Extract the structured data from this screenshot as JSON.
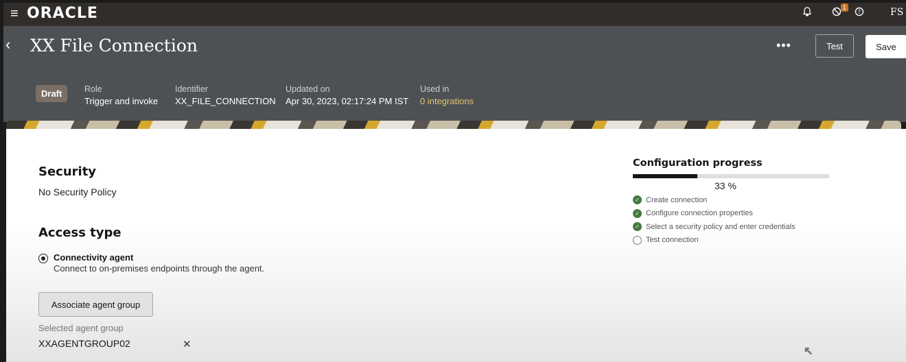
{
  "topbar": {
    "logo": "ORACLE",
    "menu_icon": "hamburger-menu-icon",
    "notification_icon": "bell-icon",
    "activity_icon": "activity-icon",
    "activity_badge": "1",
    "help_icon": "help-icon",
    "user_initials": "FS",
    "colors": {
      "background": "#302d2b",
      "badge": "#c7762b"
    }
  },
  "header": {
    "title": "XX File Connection",
    "more_label": "•••",
    "test_label": "Test",
    "save_label": "Save",
    "status_badge": "Draft",
    "meta": {
      "role_label": "Role",
      "role_value": "Trigger and invoke",
      "identifier_label": "Identifier",
      "identifier_value": "XX_FILE_CONNECTION",
      "updated_label": "Updated on",
      "updated_value": "Apr 30, 2023, 02:17:24 PM IST",
      "used_label": "Used in",
      "used_value": "0 integrations"
    },
    "colors": {
      "background": "#4e5154",
      "link": "#e3c56e"
    }
  },
  "security": {
    "title": "Security",
    "value": "No Security Policy"
  },
  "access": {
    "title": "Access type",
    "option_title": "Connectivity agent",
    "option_desc": "Connect to on-premises endpoints through the agent.",
    "option_selected": true,
    "associate_button": "Associate agent group",
    "selected_label": "Selected agent group",
    "selected_value": "XXAGENTGROUP02",
    "clear_icon": "close-icon"
  },
  "progress": {
    "title": "Configuration progress",
    "percent": 33,
    "percent_text": "33 %",
    "steps": [
      {
        "label": "Create connection",
        "done": true
      },
      {
        "label": "Configure connection properties",
        "done": true
      },
      {
        "label": "Select a security policy and enter credentials",
        "done": true
      },
      {
        "label": "Test connection",
        "done": false
      }
    ],
    "colors": {
      "done": "#457a3f",
      "fill": "#161616"
    }
  }
}
